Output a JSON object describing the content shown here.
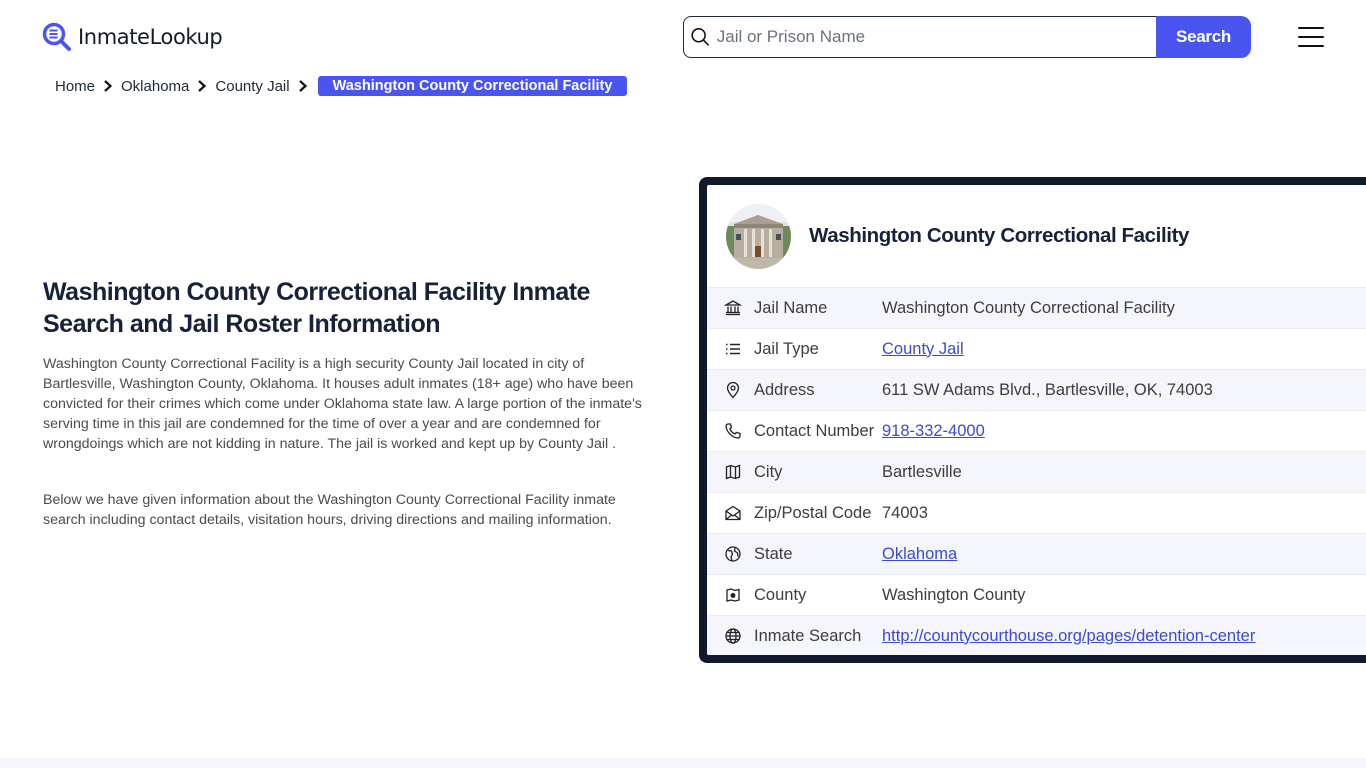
{
  "header": {
    "logo_text": "InmateLookup",
    "search_placeholder": "Jail or Prison Name",
    "search_value": "",
    "search_button": "Search",
    "brand_color": "#4a55f0"
  },
  "breadcrumb": {
    "items": [
      "Home",
      "Oklahoma",
      "County Jail"
    ],
    "current": "Washington County Correctional Facility"
  },
  "main": {
    "title": "Washington County Correctional Facility Inmate Search and Jail Roster Information",
    "paragraphs": [
      "Washington County Correctional Facility is a high security County Jail located in city of Bartlesville, Washington County, Oklahoma. It houses adult inmates (18+ age) who have been convicted for their crimes which come under Oklahoma state law. A large portion of the inmate's serving time in this jail are condemned for the time of over a year and are condemned for wrongdoings which are not kidding in nature. The jail is worked and kept up by County Jail .",
      "Below we have given information about the Washington County Correctional Facility inmate search including contact details, visitation hours, driving directions and mailing information."
    ]
  },
  "card": {
    "title": "Washington County Correctional Facility",
    "avatar_alt": "courthouse building photo",
    "rows": [
      {
        "icon": "bank-icon",
        "label": "Jail Name",
        "value": "Washington County Correctional Facility",
        "link": false
      },
      {
        "icon": "list-icon",
        "label": "Jail Type",
        "value": "County Jail",
        "link": true
      },
      {
        "icon": "map-pin-icon",
        "label": "Address",
        "value": "611 SW Adams Blvd., Bartlesville, OK, 74003",
        "link": false
      },
      {
        "icon": "phone-icon",
        "label": "Contact Number",
        "value": "918-332-4000",
        "link": true
      },
      {
        "icon": "map-icon",
        "label": "City",
        "value": "Bartlesville",
        "link": false
      },
      {
        "icon": "mail-open-icon",
        "label": "Zip/Postal Code",
        "value": "74003",
        "link": false
      },
      {
        "icon": "globe-region-icon",
        "label": "State",
        "value": "Oklahoma",
        "link": true
      },
      {
        "icon": "county-map-icon",
        "label": "County",
        "value": "Washington County",
        "link": false
      },
      {
        "icon": "globe-icon",
        "label": "Inmate Search",
        "value": "http://countycourthouse.org/pages/detention-center",
        "link": true
      }
    ]
  }
}
